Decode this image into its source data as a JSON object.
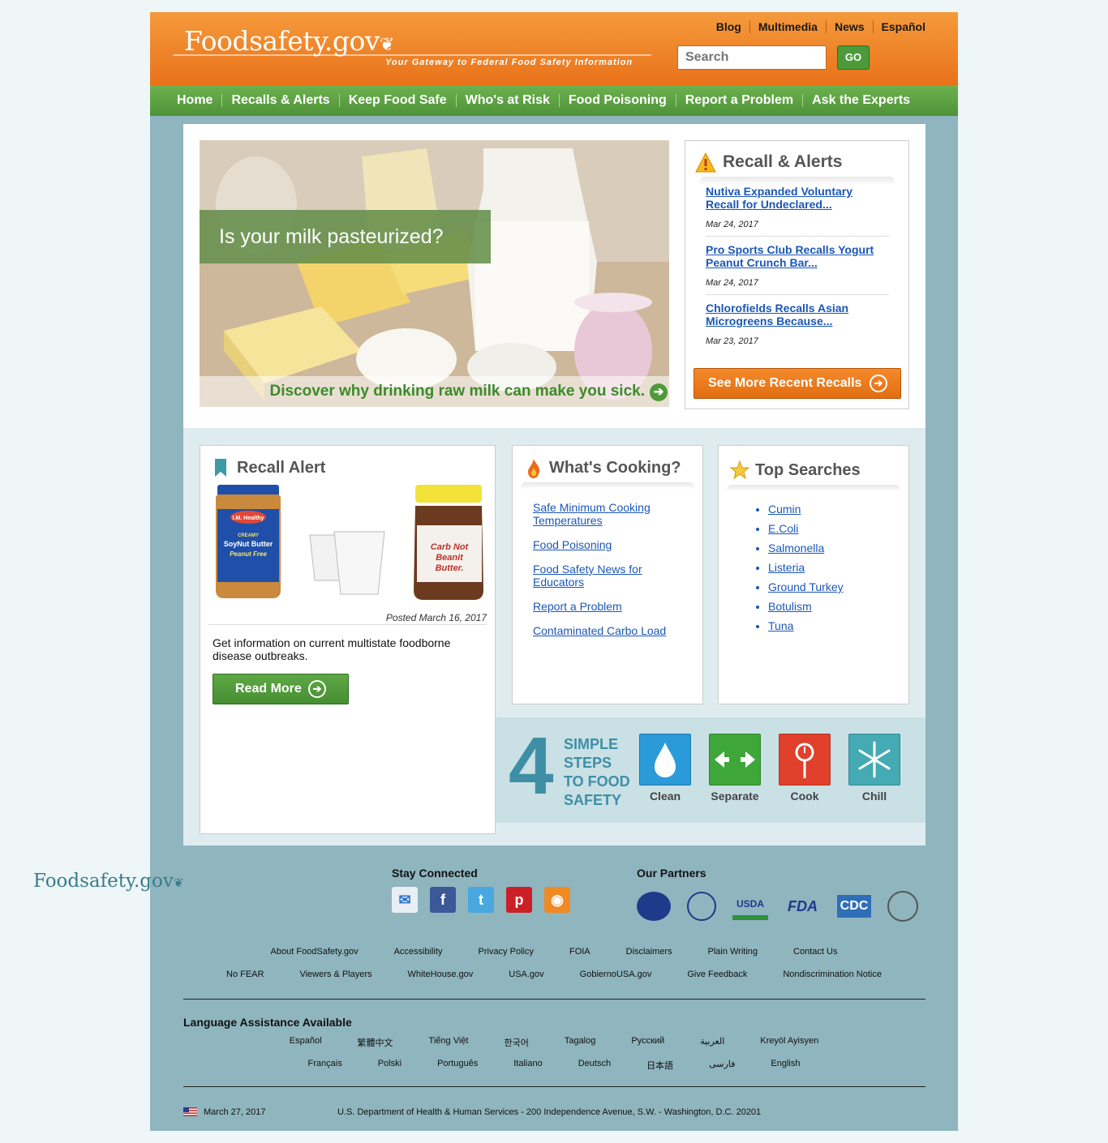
{
  "site": {
    "logo": "Foodsafety.gov",
    "tagline": "Your Gateway to Federal Food Safety Information"
  },
  "toplinks": [
    "Blog",
    "Multimedia",
    "News",
    "Español"
  ],
  "search": {
    "placeholder": "Search",
    "go": "GO"
  },
  "nav": [
    "Home",
    "Recalls & Alerts",
    "Keep Food Safe",
    "Who's at Risk",
    "Food Poisoning",
    "Report a Problem",
    "Ask the Experts"
  ],
  "hero": {
    "caption": "Is your milk pasteurized?",
    "link": "Discover why drinking raw milk can make you sick."
  },
  "recalls": {
    "title": "Recall & Alerts",
    "items": [
      {
        "title": "Nutiva Expanded Voluntary Recall for Undeclared...",
        "date": "Mar 24, 2017"
      },
      {
        "title": "Pro Sports Club Recalls Yogurt Peanut Crunch Bar...",
        "date": "Mar 24, 2017"
      },
      {
        "title": "Chlorofields Recalls Asian Microgreens Because...",
        "date": "Mar 23, 2017"
      }
    ],
    "button": "See More Recent Recalls"
  },
  "recall_alert": {
    "title": "Recall Alert",
    "posted": "Posted March 16, 2017",
    "text": "Get information on current multistate foodborne disease outbreaks.",
    "button": "Read More",
    "jar1": {
      "brand": "I.M. Healthy",
      "l1": "CREAMY",
      "l2": "SoyNut Butter",
      "l3": "Peanut Free"
    },
    "jar2": {
      "l1": "Carb Not",
      "l2": "Beanit",
      "l3": "Butter."
    }
  },
  "whats_cooking": {
    "title": "What's Cooking?",
    "links": [
      "Safe Minimum Cooking Temperatures",
      "Food Poisoning",
      "Food Safety News for Educators",
      "Report a Problem",
      "Contaminated Carbo Load"
    ]
  },
  "top_searches": {
    "title": "Top Searches",
    "items": [
      "Cumin",
      "E.Coli",
      "Salmonella",
      "Listeria",
      "Ground Turkey",
      "Botulism",
      "Tuna"
    ]
  },
  "four_steps": {
    "number": "4",
    "lines": [
      "SIMPLE",
      "STEPS",
      "TO FOOD",
      "SAFETY"
    ],
    "steps": [
      {
        "label": "Clean",
        "color": "#2a9ad8"
      },
      {
        "label": "Separate",
        "color": "#3fa63a"
      },
      {
        "label": "Cook",
        "color": "#e0402c"
      },
      {
        "label": "Chill",
        "color": "#44aab4"
      }
    ]
  },
  "footer": {
    "logo": "Foodsafety.gov",
    "stay_connected": "Stay Connected",
    "our_partners": "Our Partners",
    "partner_usda": "USDA",
    "partner_fda": "FDA",
    "partner_cdc": "CDC",
    "links_row1": [
      "About FoodSafety.gov",
      "Accessibility",
      "Privacy Policy",
      "FOIA",
      "Disclaimers",
      "Plain Writing",
      "Contact Us"
    ],
    "links_row2": [
      "No FEAR",
      "Viewers & Players",
      "WhiteHouse.gov",
      "USA.gov",
      "GobiernoUSA.gov",
      "Give Feedback",
      "Nondiscrimination Notice"
    ],
    "lang_title": "Language Assistance Available",
    "lang_row1": [
      "Español",
      "繁體中文",
      "Tiếng Việt",
      "한국어",
      "Tagalog",
      "Русский",
      "العربية",
      "Kreyòl Ayisyen"
    ],
    "lang_row2": [
      "Français",
      "Polski",
      "Português",
      "Italiano",
      "Deutsch",
      "日本語",
      "فارسی",
      "English"
    ],
    "date": "March 27, 2017",
    "address": "U.S. Department of Health & Human Services - 200 Independence Avenue, S.W. - Washington, D.C. 20201"
  },
  "colors": {
    "orange": "#e9721a",
    "green": "#4f9238",
    "link": "#1b57b5",
    "teal": "#3e8fa6"
  }
}
